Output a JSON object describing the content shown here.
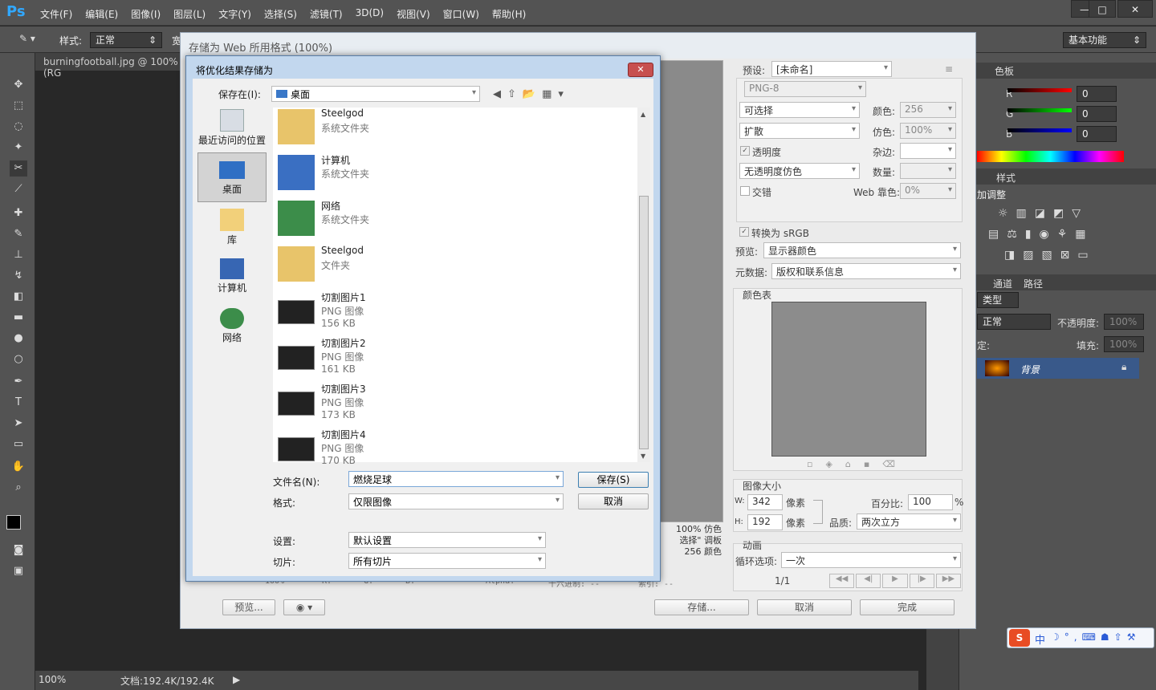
{
  "app": {
    "logo": "Ps",
    "menu": [
      "文件(F)",
      "编辑(E)",
      "图像(I)",
      "图层(L)",
      "文字(Y)",
      "选择(S)",
      "滤镜(T)",
      "3D(D)",
      "视图(V)",
      "窗口(W)",
      "帮助(H)"
    ],
    "workspace": "基本功能"
  },
  "options": {
    "style_label": "样式:",
    "style_value": "正常",
    "width_label": "宽"
  },
  "document": {
    "tab": "burningfootball.jpg @ 100%(RG",
    "zoom": "100%",
    "doc_info": "文档:192.4K/192.4K"
  },
  "web": {
    "title": "存储为 Web 所用格式 (100%)",
    "preset_label": "预设:",
    "preset_value": "[未命名]",
    "format": "PNG-8",
    "reduction": "可选择",
    "dither_algo": "扩散",
    "colors_label": "颜色:",
    "colors_value": "256",
    "dither_label": "仿色:",
    "dither_value": "100%",
    "transparency": "透明度",
    "matte_label": "杂边:",
    "trans_dither": "无透明度仿色",
    "amount_label": "数量:",
    "interlaced": "交错",
    "websnap_label": "Web 靠色:",
    "websnap_value": "0%",
    "convert_srgb": "转换为 sRGB",
    "preview_label": "预览:",
    "preview_value": "显示器颜色",
    "metadata_label": "元数据:",
    "metadata_value": "版权和联系信息",
    "color_table": "颜色表",
    "image_size": "图像大小",
    "w_label": "W:",
    "w_value": "342",
    "h_label": "H:",
    "h_value": "192",
    "px": "像素",
    "percent_label": "百分比:",
    "percent_value": "100",
    "percent_sign": "%",
    "quality_label": "品质:",
    "quality_value": "两次立方",
    "animation": "动画",
    "loop_label": "循环选项:",
    "loop_value": "一次",
    "frame": "1/1",
    "info_lines": [
      "100% 仿色",
      "选择\" 调板",
      "256 颜色"
    ],
    "zoom": "100%",
    "status_r": "R: --",
    "status_g": "G: --",
    "status_b": "B: --",
    "status_alpha": "Alpha: --",
    "status_hex": "十六进制: --",
    "status_index": "索引: --",
    "btn_preview": "预览...",
    "btn_save": "存储...",
    "btn_cancel": "取消",
    "btn_done": "完成"
  },
  "dialog": {
    "title": "将优化结果存储为",
    "save_in_label": "保存在(I):",
    "location": "桌面",
    "nav": [
      {
        "label": "最近访问的位置"
      },
      {
        "label": "桌面"
      },
      {
        "label": "库"
      },
      {
        "label": "计算机"
      },
      {
        "label": "网络"
      }
    ],
    "files": [
      {
        "name": "Steelgod",
        "type": "系统文件夹",
        "size": ""
      },
      {
        "name": "计算机",
        "type": "系统文件夹",
        "size": ""
      },
      {
        "name": "网络",
        "type": "系统文件夹",
        "size": ""
      },
      {
        "name": "Steelgod",
        "type": "文件夹",
        "size": ""
      },
      {
        "name": "切割图片1",
        "type": "PNG 图像",
        "size": "156 KB"
      },
      {
        "name": "切割图片2",
        "type": "PNG 图像",
        "size": "161 KB"
      },
      {
        "name": "切割图片3",
        "type": "PNG 图像",
        "size": "173 KB"
      },
      {
        "name": "切割图片4",
        "type": "PNG 图像",
        "size": "170 KB"
      }
    ],
    "filename_label": "文件名(N):",
    "filename_value": "燃烧足球",
    "format_label": "格式:",
    "format_value": "仅限图像",
    "settings_label": "设置:",
    "settings_value": "默认设置",
    "slices_label": "切片:",
    "slices_value": "所有切片",
    "save": "保存(S)",
    "cancel": "取消",
    "close": "✕"
  },
  "panels": {
    "color_tab": "色板",
    "r": "R",
    "g": "G",
    "b": "B",
    "rv": "0",
    "gv": "0",
    "bv": "0",
    "adj_tab": "样式",
    "adj_title": "加调整",
    "layers_tabs": [
      "通道",
      "路径"
    ],
    "kind": "类型",
    "blend": "正常",
    "opacity_label": "不透明度:",
    "opacity_value": "100%",
    "lock_label": "定:",
    "fill_label": "填充:",
    "fill_value": "100%",
    "layer_name": "背景"
  },
  "ime": {
    "text": "中"
  }
}
